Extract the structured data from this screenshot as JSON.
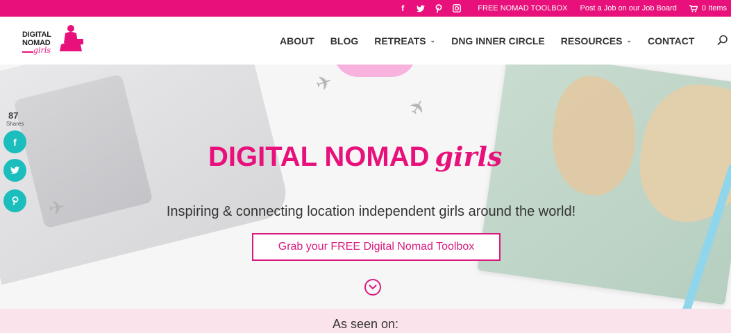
{
  "colors": {
    "brand": "#e8107a",
    "accent": "#d81b7e",
    "share": "#1bbdbd",
    "seen_bg": "#fbe3ec"
  },
  "topbar": {
    "social_icons": [
      "facebook-icon",
      "twitter-icon",
      "pinterest-icon",
      "instagram-icon"
    ],
    "toolbox_link": "FREE NOMAD TOOLBOX",
    "job_link": "Post a Job on our Job Board",
    "cart_label": "0 Items"
  },
  "logo": {
    "line1": "DIGITAL",
    "line2": "NOMAD",
    "line3": "girls"
  },
  "nav": {
    "about": "ABOUT",
    "blog": "BLOG",
    "retreats": "RETREATS",
    "inner_circle": "DNG INNER CIRCLE",
    "resources": "RESOURCES",
    "contact": "CONTACT"
  },
  "share": {
    "count": "87",
    "label": "Shares",
    "buttons": [
      "facebook",
      "twitter",
      "pinterest"
    ]
  },
  "hero": {
    "title_main": "DIGITAL NOMAD",
    "title_script": "girls",
    "tagline": "Inspiring & connecting location independent girls around the world!",
    "cta": "Grab your FREE Digital Nomad Toolbox"
  },
  "seen_on": {
    "heading": "As seen on:"
  }
}
